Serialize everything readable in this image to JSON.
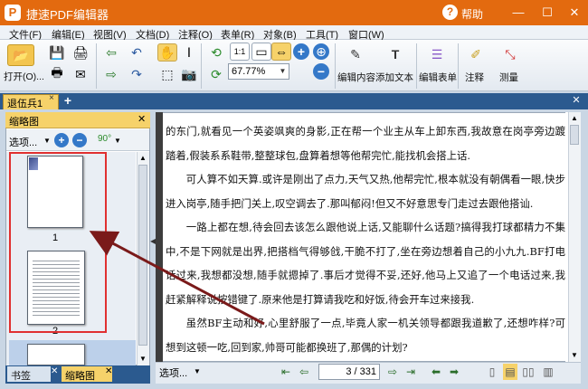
{
  "app": {
    "icon_letter": "P",
    "title": "捷速PDF编辑器",
    "help": "帮助"
  },
  "window": {
    "minimize": "—",
    "maximize": "☐",
    "close": "✕"
  },
  "menu": [
    "文件(F)",
    "编辑(E)",
    "视图(V)",
    "文档(D)",
    "注释(O)",
    "表单(R)",
    "对象(B)",
    "工具(T)",
    "窗口(W)"
  ],
  "toolbar": {
    "open_label": "打开(O)...",
    "zoom_value": "67.77%",
    "edit_content": "编辑内容",
    "add_text": "添加文本",
    "edit_form": "编辑表单",
    "annotate": "注释",
    "measure": "测量"
  },
  "tabs": {
    "doc_tab": "退伍兵1",
    "close": "×",
    "add": "+"
  },
  "thumbnails": {
    "header": "缩略图",
    "options": "选项...",
    "rotate_value": "90°",
    "pages": [
      {
        "label": "1"
      },
      {
        "label": "2"
      }
    ]
  },
  "bottom_tabs": {
    "bookmarks": "书签",
    "thumbnails": "缩略图"
  },
  "document": {
    "paragraphs": [
      "的东门,就看见一个英姿飒爽的身影,正在帮一个业主从车上卸东西,我故意在岗亭旁边踱踏着,假装系系鞋带,整整球包,盘算着想等他帮完忙,能找机会搭上话.",
      "可人算不如天算.或许是刚出了点力,天气又热,他帮完忙,根本就没有朝偶看一眼,快步进入岗亭,随手把门关上,叹空调去了.那叫郁闷!但又不好意思专门走过去跟他搭讪.",
      "一路上都在想,待会回去该怎么跟他说上话,又能聊什么话题?搞得我打球都精力不集中,不是下网就是出界,把搭档气得够戗,干脆不打了,坐在旁边想着自己的小九九.BF打电话过来,我想都没想,随手就摁掉了.事后才觉得不妥,还好,他马上又追了一个电话过来,我赶紧解释说按错键了.原来他是打算请我吃和好饭,待会开车过来接我.",
      "虽然BF主动和好,心里舒服了一点,毕竟人家一机关领导都跟我道歉了,还想咋样?可想到这顿一吃,回到家,帅哥可能都换班了,那偶的计划?"
    ]
  },
  "statusbar": {
    "options": "选项...",
    "page_current": "3",
    "page_total": "331"
  }
}
